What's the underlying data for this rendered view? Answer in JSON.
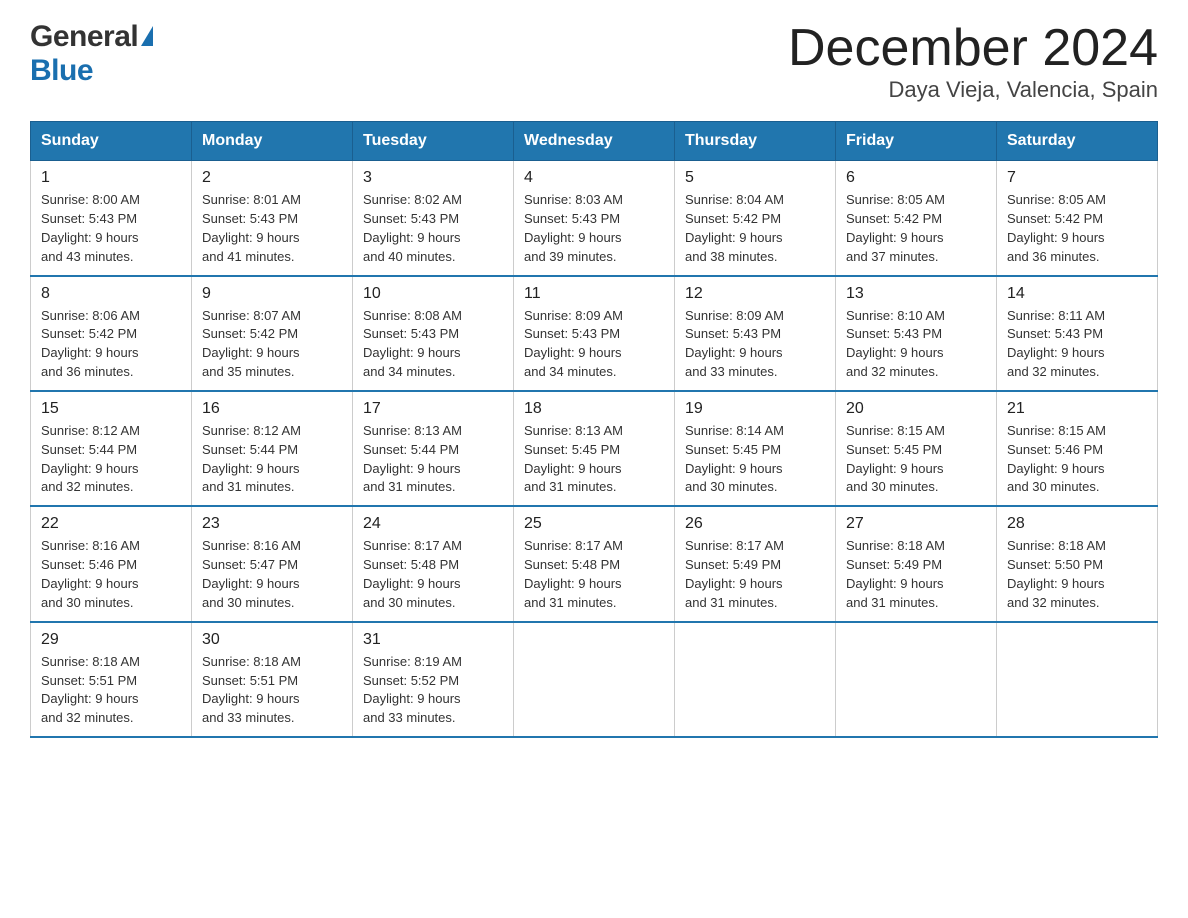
{
  "logo": {
    "general": "General",
    "blue": "Blue",
    "triangle": "▶"
  },
  "title": "December 2024",
  "subtitle": "Daya Vieja, Valencia, Spain",
  "weekdays": [
    "Sunday",
    "Monday",
    "Tuesday",
    "Wednesday",
    "Thursday",
    "Friday",
    "Saturday"
  ],
  "weeks": [
    [
      {
        "day": "1",
        "sunrise": "8:00 AM",
        "sunset": "5:43 PM",
        "daylight": "9 hours and 43 minutes."
      },
      {
        "day": "2",
        "sunrise": "8:01 AM",
        "sunset": "5:43 PM",
        "daylight": "9 hours and 41 minutes."
      },
      {
        "day": "3",
        "sunrise": "8:02 AM",
        "sunset": "5:43 PM",
        "daylight": "9 hours and 40 minutes."
      },
      {
        "day": "4",
        "sunrise": "8:03 AM",
        "sunset": "5:43 PM",
        "daylight": "9 hours and 39 minutes."
      },
      {
        "day": "5",
        "sunrise": "8:04 AM",
        "sunset": "5:42 PM",
        "daylight": "9 hours and 38 minutes."
      },
      {
        "day": "6",
        "sunrise": "8:05 AM",
        "sunset": "5:42 PM",
        "daylight": "9 hours and 37 minutes."
      },
      {
        "day": "7",
        "sunrise": "8:05 AM",
        "sunset": "5:42 PM",
        "daylight": "9 hours and 36 minutes."
      }
    ],
    [
      {
        "day": "8",
        "sunrise": "8:06 AM",
        "sunset": "5:42 PM",
        "daylight": "9 hours and 36 minutes."
      },
      {
        "day": "9",
        "sunrise": "8:07 AM",
        "sunset": "5:42 PM",
        "daylight": "9 hours and 35 minutes."
      },
      {
        "day": "10",
        "sunrise": "8:08 AM",
        "sunset": "5:43 PM",
        "daylight": "9 hours and 34 minutes."
      },
      {
        "day": "11",
        "sunrise": "8:09 AM",
        "sunset": "5:43 PM",
        "daylight": "9 hours and 34 minutes."
      },
      {
        "day": "12",
        "sunrise": "8:09 AM",
        "sunset": "5:43 PM",
        "daylight": "9 hours and 33 minutes."
      },
      {
        "day": "13",
        "sunrise": "8:10 AM",
        "sunset": "5:43 PM",
        "daylight": "9 hours and 32 minutes."
      },
      {
        "day": "14",
        "sunrise": "8:11 AM",
        "sunset": "5:43 PM",
        "daylight": "9 hours and 32 minutes."
      }
    ],
    [
      {
        "day": "15",
        "sunrise": "8:12 AM",
        "sunset": "5:44 PM",
        "daylight": "9 hours and 32 minutes."
      },
      {
        "day": "16",
        "sunrise": "8:12 AM",
        "sunset": "5:44 PM",
        "daylight": "9 hours and 31 minutes."
      },
      {
        "day": "17",
        "sunrise": "8:13 AM",
        "sunset": "5:44 PM",
        "daylight": "9 hours and 31 minutes."
      },
      {
        "day": "18",
        "sunrise": "8:13 AM",
        "sunset": "5:45 PM",
        "daylight": "9 hours and 31 minutes."
      },
      {
        "day": "19",
        "sunrise": "8:14 AM",
        "sunset": "5:45 PM",
        "daylight": "9 hours and 30 minutes."
      },
      {
        "day": "20",
        "sunrise": "8:15 AM",
        "sunset": "5:45 PM",
        "daylight": "9 hours and 30 minutes."
      },
      {
        "day": "21",
        "sunrise": "8:15 AM",
        "sunset": "5:46 PM",
        "daylight": "9 hours and 30 minutes."
      }
    ],
    [
      {
        "day": "22",
        "sunrise": "8:16 AM",
        "sunset": "5:46 PM",
        "daylight": "9 hours and 30 minutes."
      },
      {
        "day": "23",
        "sunrise": "8:16 AM",
        "sunset": "5:47 PM",
        "daylight": "9 hours and 30 minutes."
      },
      {
        "day": "24",
        "sunrise": "8:17 AM",
        "sunset": "5:48 PM",
        "daylight": "9 hours and 30 minutes."
      },
      {
        "day": "25",
        "sunrise": "8:17 AM",
        "sunset": "5:48 PM",
        "daylight": "9 hours and 31 minutes."
      },
      {
        "day": "26",
        "sunrise": "8:17 AM",
        "sunset": "5:49 PM",
        "daylight": "9 hours and 31 minutes."
      },
      {
        "day": "27",
        "sunrise": "8:18 AM",
        "sunset": "5:49 PM",
        "daylight": "9 hours and 31 minutes."
      },
      {
        "day": "28",
        "sunrise": "8:18 AM",
        "sunset": "5:50 PM",
        "daylight": "9 hours and 32 minutes."
      }
    ],
    [
      {
        "day": "29",
        "sunrise": "8:18 AM",
        "sunset": "5:51 PM",
        "daylight": "9 hours and 32 minutes."
      },
      {
        "day": "30",
        "sunrise": "8:18 AM",
        "sunset": "5:51 PM",
        "daylight": "9 hours and 33 minutes."
      },
      {
        "day": "31",
        "sunrise": "8:19 AM",
        "sunset": "5:52 PM",
        "daylight": "9 hours and 33 minutes."
      },
      null,
      null,
      null,
      null
    ]
  ],
  "labels": {
    "sunrise": "Sunrise:",
    "sunset": "Sunset:",
    "daylight": "Daylight:"
  }
}
